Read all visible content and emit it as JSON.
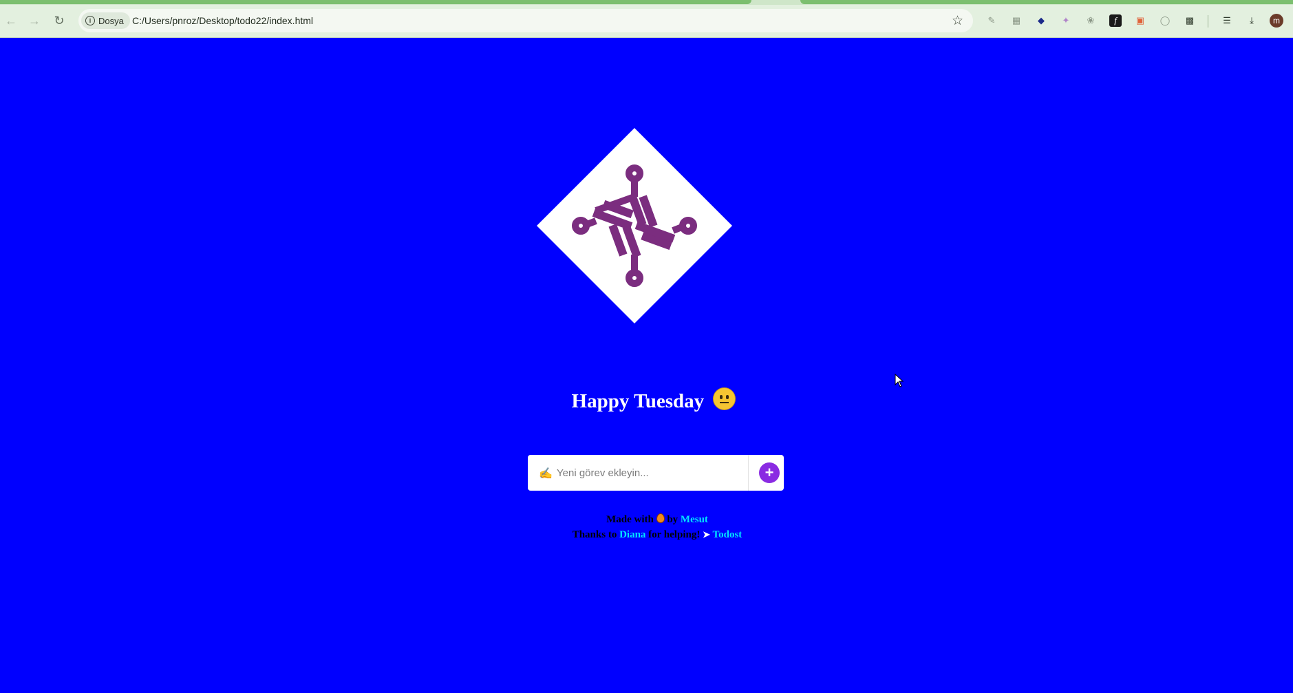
{
  "browser": {
    "site_chip": "Dosya",
    "url": "C:/Users/pnroz/Desktop/todo22/index.html",
    "avatar_letter": "m"
  },
  "page": {
    "background_color": "#0000ff",
    "logo": {
      "name": "todo-logo",
      "diamond_color": "#ffffff",
      "mark_color": "#7b2d7f"
    },
    "greeting": "Happy Tuesday",
    "greeting_emoji": "neutral-face-emoji",
    "todo_input": {
      "placeholder": "Yeni görev ekleyin...",
      "value": ""
    },
    "add_button": "+",
    "credits": {
      "made_with": "Made with",
      "by": "by",
      "author": "Mesut",
      "thanks_to": "Thanks to",
      "helper": "Diana",
      "for_helping": "for helping!",
      "project": "Todost",
      "link_color": "#00e5ff"
    }
  }
}
